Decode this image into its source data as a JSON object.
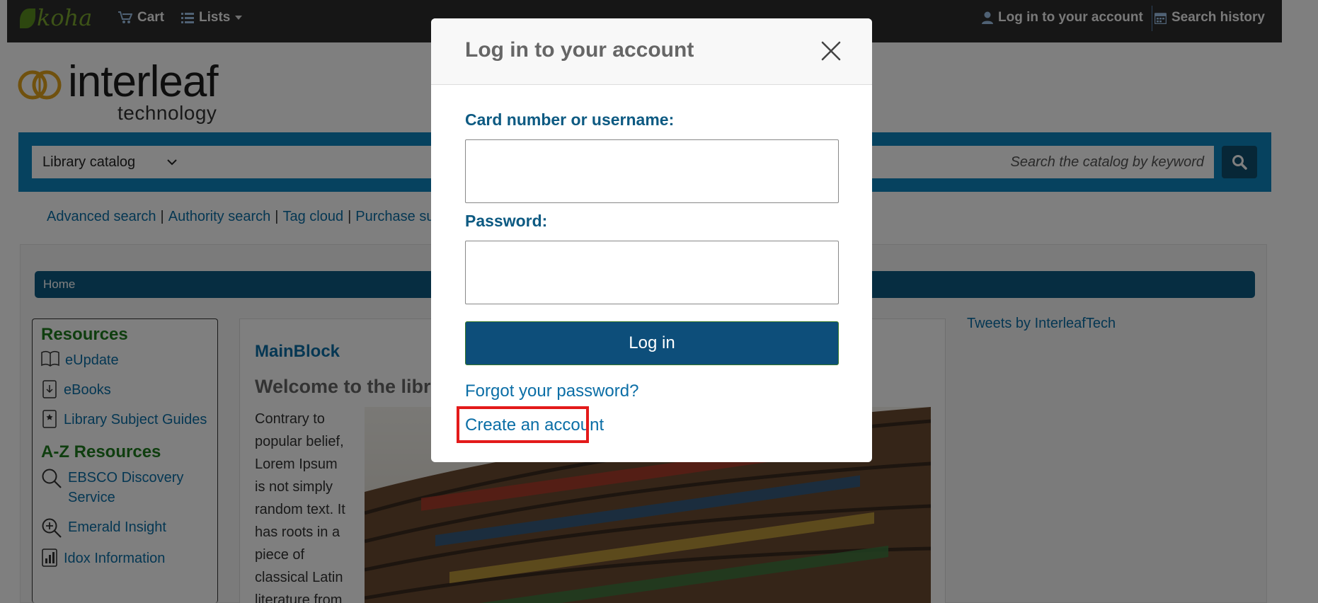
{
  "navbar": {
    "logo": "koha",
    "cart": "Cart",
    "lists": "Lists",
    "login": "Log in to your account",
    "history": "Search history"
  },
  "brand": {
    "word": "interleaf",
    "sub": "technology"
  },
  "search": {
    "select": "Library catalog",
    "placeholder": "Search the catalog by keyword"
  },
  "links": [
    "Advanced search",
    "Authority search",
    "Tag cloud",
    "Purchase su"
  ],
  "breadcrumb": "Home",
  "sidebar": {
    "resources_title": "Resources",
    "resources": [
      {
        "label": "eUpdate",
        "icon": "book-open-icon"
      },
      {
        "label": "eBooks",
        "icon": "download-file-icon"
      },
      {
        "label": "Library Subject Guides",
        "icon": "bookmark-icon"
      }
    ],
    "az_title": "A-Z Resources",
    "az": [
      {
        "label": "EBSCO Discovery Service",
        "icon": "search-icon"
      },
      {
        "label": "Emerald Insight",
        "icon": "zoom-in-icon"
      },
      {
        "label": "Idox Information",
        "icon": "bar-chart-icon"
      }
    ]
  },
  "main": {
    "title": "MainBlock",
    "welcome": "Welcome to the libr",
    "para": "Contrary to popular belief, Lorem Ipsum is not simply random text. It has roots in a piece of classical Latin literature from"
  },
  "tweets": "Tweets by InterleafTech",
  "modal": {
    "title": "Log in to your account",
    "user_label": "Card number or username:",
    "user_value": "",
    "pass_label": "Password:",
    "pass_value": "",
    "login_button": "Log in",
    "forgot": "Forgot your password?",
    "create": "Create an account"
  },
  "colors": {
    "navbar": "#2c2c2c",
    "search_bar": "#0d84bf",
    "breadcrumb": "#0d5a82",
    "login_button": "#0d4e7a",
    "highlight": "#e31a1a",
    "resources_green": "#1f7d1f"
  }
}
